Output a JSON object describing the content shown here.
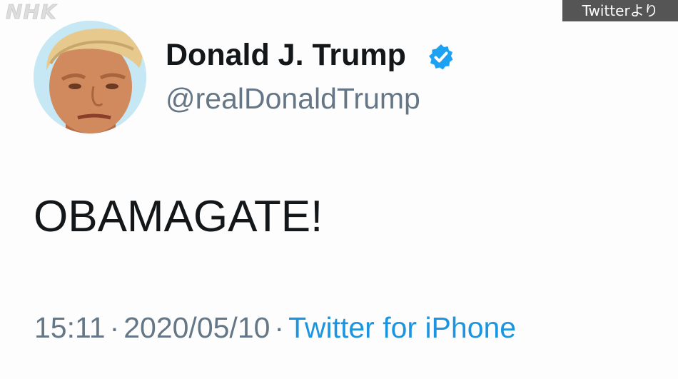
{
  "overlay": {
    "watermark": "NHK",
    "source_badge": "Twitterより"
  },
  "tweet": {
    "avatar_icon": "profile-photo",
    "display_name": "Donald J. Trump",
    "verified_icon": "verified-badge-icon",
    "handle": "@realDonaldTrump",
    "text": "OBAMAGATE!",
    "time": "15:11",
    "separator": "·",
    "date": "2020/05/10",
    "source": "Twitter for iPhone"
  },
  "colors": {
    "text_primary": "#14171a",
    "text_secondary": "#657786",
    "link": "#1b95e0",
    "verified": "#1da1f2",
    "badge_bg": "#555555"
  }
}
